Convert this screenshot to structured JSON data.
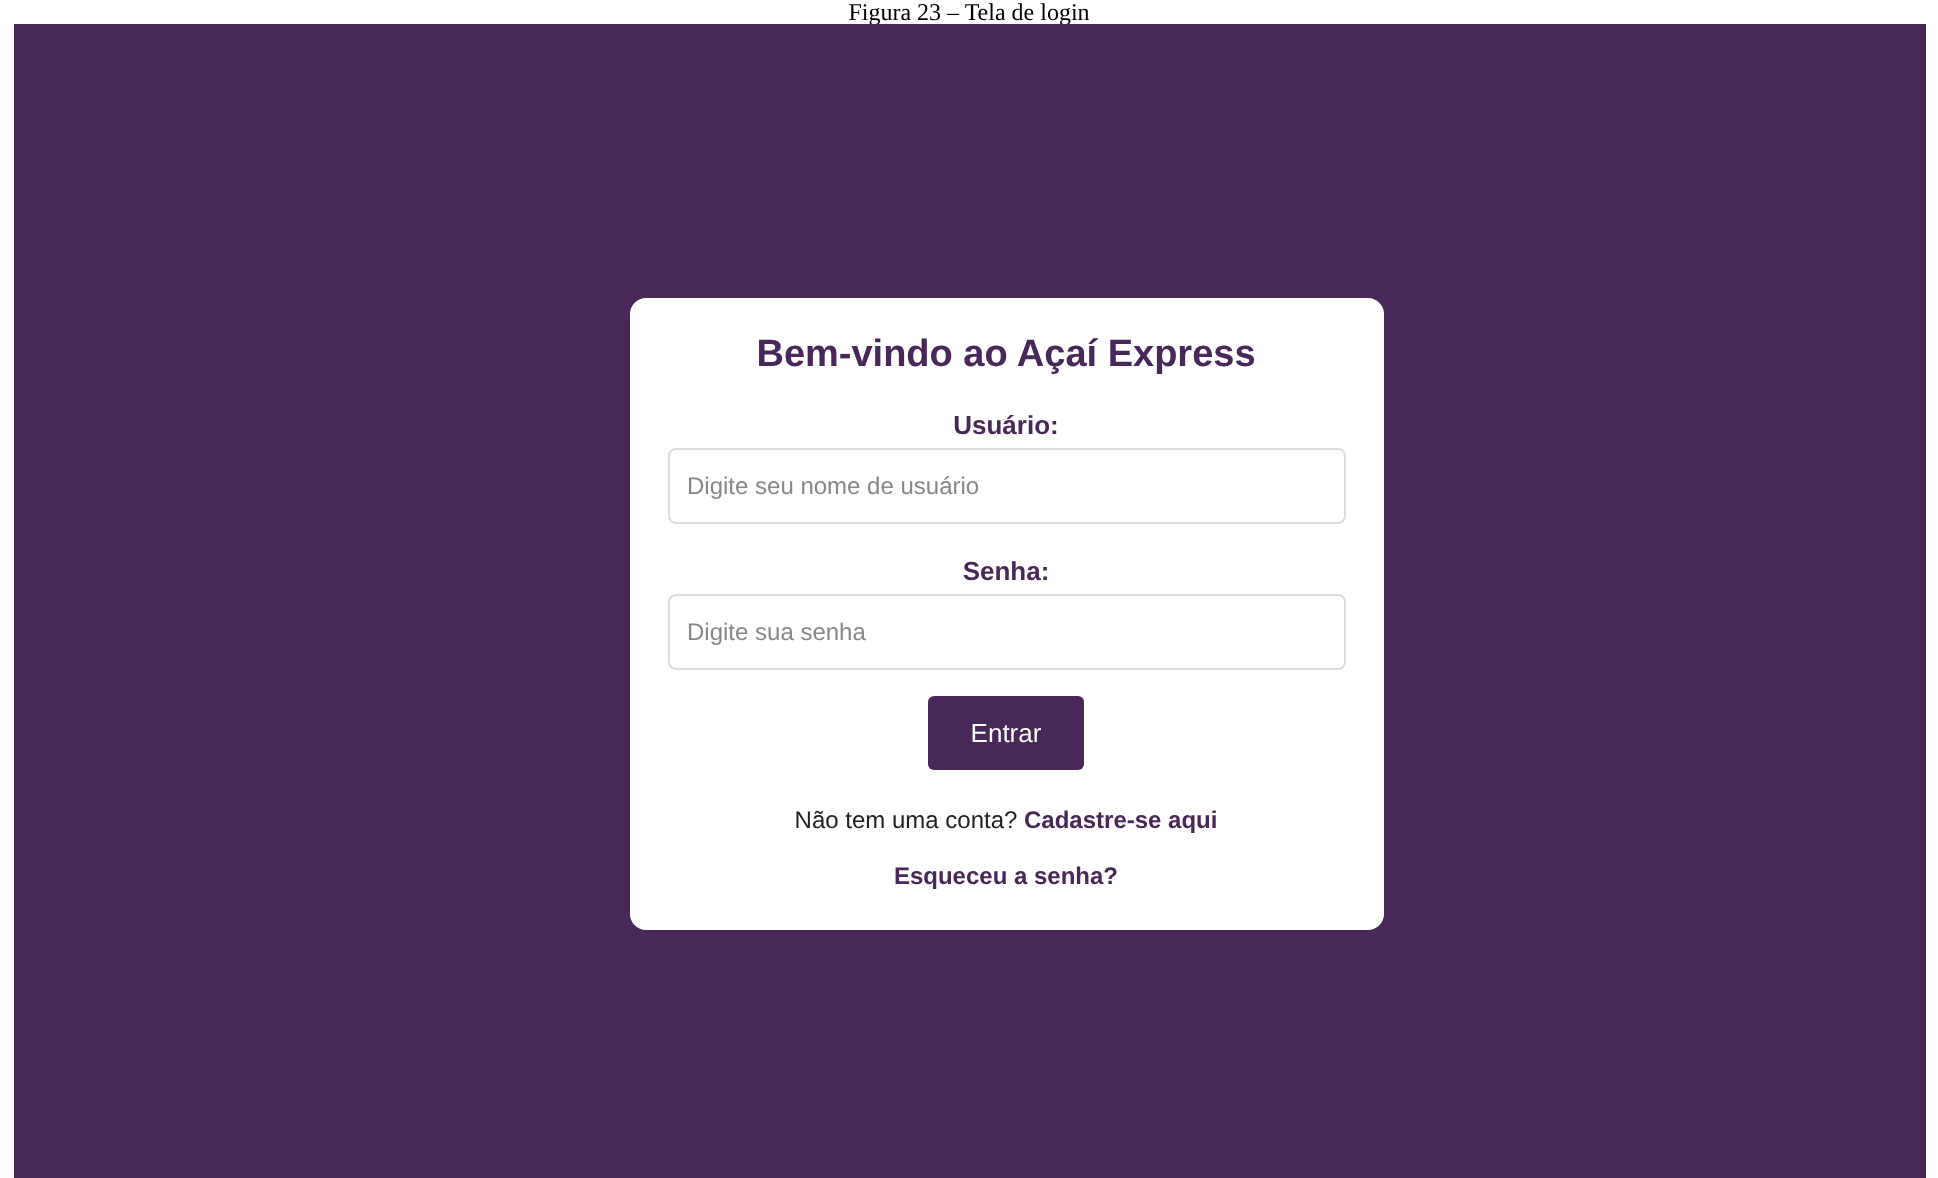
{
  "caption": "Figura 23 – Tela de login",
  "login_card": {
    "title": "Bem-vindo ao Açaí Express",
    "fields": [
      {
        "label": "Usuário:",
        "placeholder": "Digite seu nome de usuário"
      },
      {
        "label": "Senha:",
        "placeholder": "Digite sua senha"
      }
    ],
    "submit_button": "Entrar",
    "signup_prompt": "Não tem uma conta?",
    "signup_link": "Cadastre-se aqui",
    "forgot_link": "Esqueceu a senha?"
  }
}
